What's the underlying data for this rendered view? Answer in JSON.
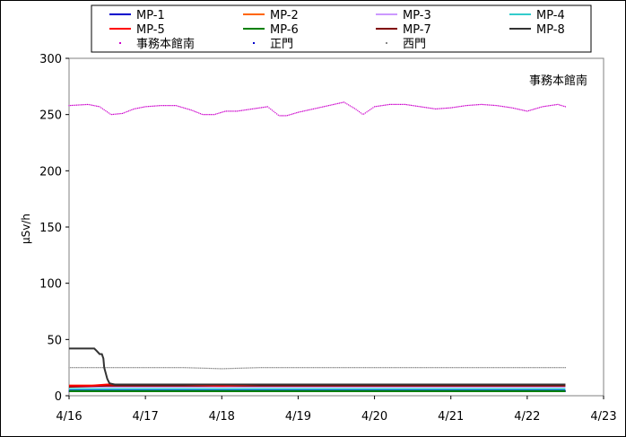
{
  "chart_data": {
    "type": "line",
    "annotation": "事務本館南",
    "ylabel": "μSv/h",
    "ylim": [
      0,
      300
    ],
    "yticks": [
      0,
      50,
      100,
      150,
      200,
      250,
      300
    ],
    "xlim": [
      "4/16",
      "4/23"
    ],
    "xticks": [
      "4/16",
      "4/17",
      "4/18",
      "4/19",
      "4/20",
      "4/21",
      "4/22",
      "4/23"
    ],
    "grid": false,
    "legend_position": "top",
    "series": [
      {
        "name": "MP-1",
        "style": "line",
        "color": "#0000cc",
        "x": [
          0.0,
          6.5
        ],
        "y": [
          5,
          5
        ]
      },
      {
        "name": "MP-2",
        "style": "line",
        "color": "#ff6600",
        "x": [
          0.0,
          6.5
        ],
        "y": [
          9,
          9
        ]
      },
      {
        "name": "MP-3",
        "style": "line",
        "color": "#cc99ff",
        "x": [
          0.0,
          6.5
        ],
        "y": [
          8,
          8
        ]
      },
      {
        "name": "MP-4",
        "style": "line",
        "color": "#33cccc",
        "x": [
          0.0,
          6.5
        ],
        "y": [
          6,
          6
        ]
      },
      {
        "name": "MP-5",
        "style": "line",
        "color": "#ff0000",
        "x": [
          0.0,
          0.3,
          0.5,
          1.0,
          1.5,
          2.0,
          2.5,
          3.0,
          3.5,
          4.0,
          4.5,
          5.0,
          5.5,
          6.0,
          6.5
        ],
        "y": [
          9,
          9,
          10,
          10,
          10,
          9,
          10,
          10,
          10,
          10,
          10,
          10,
          10,
          10,
          10
        ]
      },
      {
        "name": "MP-6",
        "style": "line",
        "color": "#008000",
        "x": [
          0.0,
          6.5
        ],
        "y": [
          4,
          4
        ]
      },
      {
        "name": "MP-7",
        "style": "line",
        "color": "#800000",
        "x": [
          0.0,
          0.5,
          1.0,
          1.5,
          2.0,
          2.5,
          3.0,
          3.5,
          4.0,
          4.5,
          5.0,
          5.5,
          6.0,
          6.5
        ],
        "y": [
          8,
          9,
          9,
          9,
          9,
          9,
          9,
          9,
          9,
          9,
          9,
          9,
          9,
          9
        ]
      },
      {
        "name": "MP-8",
        "style": "line",
        "color": "#333333",
        "x": [
          0.0,
          0.33,
          0.36,
          0.4,
          0.43,
          0.45,
          0.46,
          0.48,
          0.5,
          0.53,
          0.6,
          1.0,
          1.5,
          2.0,
          2.5,
          3.0,
          3.5,
          4.0,
          4.5,
          5.0,
          5.5,
          6.0,
          6.5
        ],
        "y": [
          42,
          42,
          40,
          37,
          37,
          33,
          25,
          20,
          15,
          11,
          10,
          10,
          10,
          10,
          10,
          10,
          10,
          10,
          10,
          10,
          10,
          10,
          10
        ]
      },
      {
        "name": "事務本館南",
        "style": "dots",
        "color": "#cc00cc",
        "x": [
          0.0,
          0.25,
          0.4,
          0.55,
          0.7,
          0.85,
          1.0,
          1.2,
          1.4,
          1.6,
          1.75,
          1.9,
          2.05,
          2.2,
          2.4,
          2.6,
          2.75,
          2.85,
          3.0,
          3.2,
          3.4,
          3.6,
          3.75,
          3.85,
          4.0,
          4.2,
          4.4,
          4.6,
          4.8,
          5.0,
          5.2,
          5.4,
          5.6,
          5.8,
          6.0,
          6.2,
          6.4,
          6.5
        ],
        "y": [
          258,
          259,
          257,
          250,
          251,
          255,
          257,
          258,
          258,
          254,
          250,
          250,
          253,
          253,
          255,
          257,
          249,
          249,
          252,
          255,
          258,
          261,
          255,
          250,
          257,
          259,
          259,
          257,
          255,
          256,
          258,
          259,
          258,
          256,
          253,
          257,
          259,
          257
        ]
      },
      {
        "name": "正門",
        "style": "dots",
        "color": "#0000cc",
        "x": [
          0.0,
          6.5
        ],
        "y": [
          4,
          4
        ]
      },
      {
        "name": "西門",
        "style": "dots",
        "color": "#888888",
        "x": [
          0.0,
          0.4,
          0.6,
          1.0,
          1.5,
          2.0,
          2.5,
          3.0,
          3.5,
          4.0,
          4.5,
          5.0,
          5.5,
          6.0,
          6.5
        ],
        "y": [
          25,
          25,
          25,
          25,
          25,
          24,
          25,
          25,
          25,
          25,
          25,
          25,
          25,
          25,
          25
        ]
      }
    ]
  }
}
